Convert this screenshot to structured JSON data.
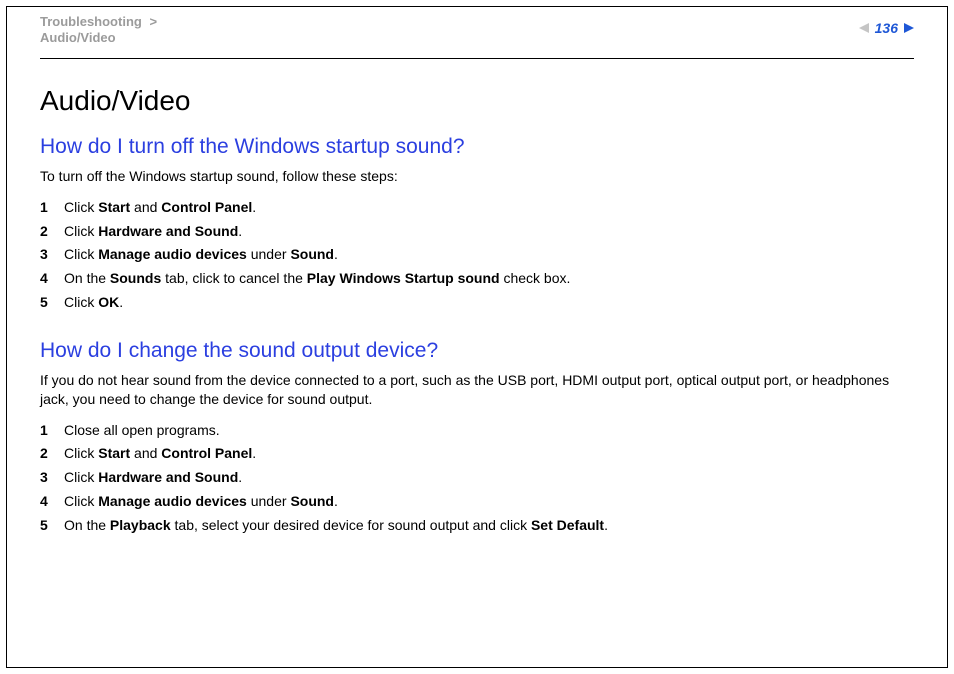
{
  "header": {
    "breadcrumb_parent": "Troubleshooting",
    "breadcrumb_sep": ">",
    "breadcrumb_child": "Audio/Video",
    "page_number": "136"
  },
  "page": {
    "title": "Audio/Video",
    "sections": [
      {
        "heading": "How do I turn off the Windows startup sound?",
        "intro": "To turn off the Windows startup sound, follow these steps:",
        "steps": [
          {
            "n": "1",
            "html": "Click <b>Start</b> and <b>Control Panel</b>."
          },
          {
            "n": "2",
            "html": "Click <b>Hardware and Sound</b>."
          },
          {
            "n": "3",
            "html": "Click <b>Manage audio devices</b> under <b>Sound</b>."
          },
          {
            "n": "4",
            "html": "On the <b>Sounds</b> tab, click to cancel the <b>Play Windows Startup sound</b> check box."
          },
          {
            "n": "5",
            "html": "Click <b>OK</b>."
          }
        ]
      },
      {
        "heading": "How do I change the sound output device?",
        "intro": "If you do not hear sound from the device connected to a port, such as the USB port, HDMI output port, optical output port, or headphones jack, you need to change the device for sound output.",
        "steps": [
          {
            "n": "1",
            "html": "Close all open programs."
          },
          {
            "n": "2",
            "html": "Click <b>Start</b> and <b>Control Panel</b>."
          },
          {
            "n": "3",
            "html": "Click <b>Hardware and Sound</b>."
          },
          {
            "n": "4",
            "html": "Click <b>Manage audio devices</b> under <b>Sound</b>."
          },
          {
            "n": "5",
            "html": "On the <b>Playback</b> tab, select your desired device for sound output and click <b>Set Default</b>."
          }
        ]
      }
    ]
  }
}
